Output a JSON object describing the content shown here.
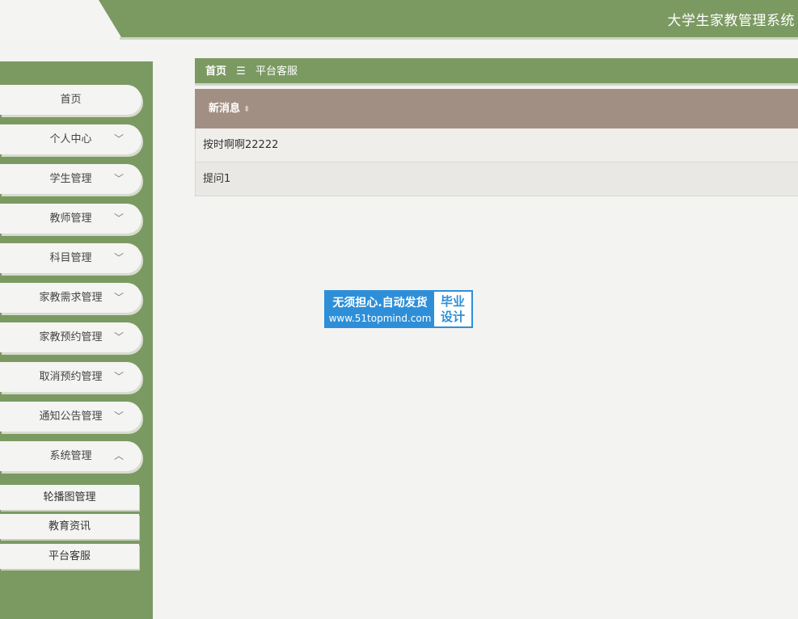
{
  "header": {
    "title": "大学生家教管理系统"
  },
  "sidebar": {
    "items": [
      {
        "label": "首页",
        "chevron": ""
      },
      {
        "label": "个人中心",
        "chevron": "﹀"
      },
      {
        "label": "学生管理",
        "chevron": "﹀"
      },
      {
        "label": "教师管理",
        "chevron": "﹀"
      },
      {
        "label": "科目管理",
        "chevron": "﹀"
      },
      {
        "label": "家教需求管理",
        "chevron": "﹀"
      },
      {
        "label": "家教预约管理",
        "chevron": "﹀"
      },
      {
        "label": "取消预约管理",
        "chevron": "﹀"
      },
      {
        "label": "通知公告管理",
        "chevron": "﹀"
      },
      {
        "label": "系统管理",
        "chevron": "︿"
      }
    ],
    "subitems": [
      {
        "label": "轮播图管理"
      },
      {
        "label": "教育资讯"
      },
      {
        "label": "平台客服"
      }
    ]
  },
  "breadcrumb": {
    "home": "首页",
    "separator": "☰",
    "current": "平台客服"
  },
  "table": {
    "header": "新消息",
    "rows": [
      "按时啊啊22222",
      "提问1"
    ]
  },
  "badge": {
    "line1": "无须担心.自动发货",
    "line2": "www.51topmind.com",
    "right1": "毕业",
    "right2": "设计"
  },
  "colors": {
    "primary_green": "#7b9a62",
    "table_header": "#a28f83",
    "badge_blue": "#2e8fd8"
  }
}
